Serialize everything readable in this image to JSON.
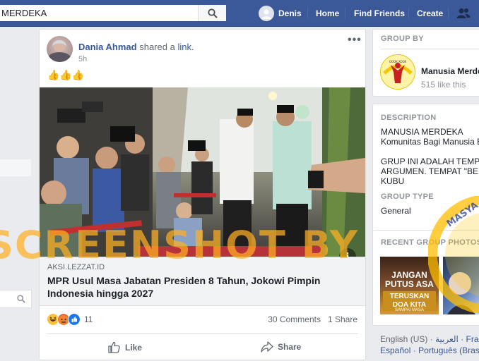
{
  "search": {
    "query": "MERDEKA"
  },
  "nav": {
    "user": "Denis",
    "home": "Home",
    "find_friends": "Find Friends",
    "create": "Create"
  },
  "post": {
    "author": "Dania Ahmad",
    "action_text": "shared a",
    "action_link": "link.",
    "time": "5h",
    "emoji": "👍👍👍",
    "more": "•••",
    "link_domain": "AKSI.LEZZAT.ID",
    "link_title": "MPR Usul Masa Jabatan Presiden 8 Tahun, Jokowi Pimpin Indonesia hingga 2027",
    "reaction_count": "11",
    "comments": "30 Comments",
    "shares": "1 Share",
    "like_label": "Like",
    "share_label": "Share",
    "reactions": [
      "haha",
      "angry",
      "like"
    ]
  },
  "group_by": {
    "header": "GROUP BY",
    "name": "Manusia Merdeka",
    "likes": "515 like this",
    "logo_text": "OOOK XOOX"
  },
  "description": {
    "header": "DESCRIPTION",
    "lines": [
      "MANUSIA MERDEKA",
      "Komunitas Bagi Manusia Bebas",
      "",
      "GRUP INI ADALAH TEMPAT",
      "ARGUMEN. TEMPAT \"BERKUMPUL",
      "KUBU"
    ],
    "type_header": "GROUP TYPE",
    "type_value": "General"
  },
  "photos": {
    "header": "RECENT GROUP PHOTOS",
    "photo1": {
      "line1": "JANGAN",
      "line2": "PUTUS ASA",
      "line3": "TERUSKAN",
      "line4": "DOA KITA",
      "line5": "SAMPAI MASA"
    }
  },
  "languages": {
    "line1": [
      "English (US)",
      "العربية",
      "Français"
    ],
    "line2": [
      "Español",
      "Português (Brasil)"
    ]
  },
  "watermark": "SCREENSHOT BY",
  "colors": {
    "brand": "#3b5998",
    "link": "#385898",
    "watermark": "#ffae23"
  }
}
